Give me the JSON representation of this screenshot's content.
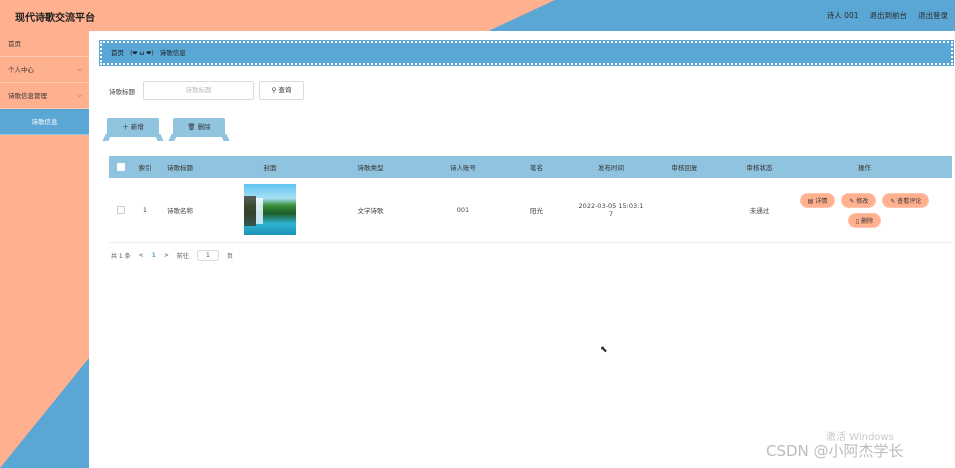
{
  "header": {
    "title": "现代诗歌交流平台",
    "nav": [
      "诗人 001",
      "退出到前台",
      "退出登录"
    ]
  },
  "sidebar": {
    "items": [
      {
        "label": "首页",
        "has_arrow": false
      },
      {
        "label": "个人中心",
        "has_arrow": true
      },
      {
        "label": "诗歌信息管理",
        "has_arrow": true
      },
      {
        "label": "诗歌信息",
        "active": true
      }
    ]
  },
  "breadcrumb": {
    "home": "首页",
    "separator": "(❤ ω ❤)",
    "current": "诗歌信息"
  },
  "search": {
    "label": "诗歌标题",
    "placeholder": "诗歌标题",
    "button": "查询"
  },
  "actions": {
    "add": "新增",
    "delete": "删除"
  },
  "table": {
    "headers": [
      "索引",
      "诗歌标题",
      "封面",
      "诗歌类型",
      "诗人账号",
      "笔名",
      "发布时间",
      "审核回复",
      "审核状态",
      "操作"
    ],
    "rows": [
      {
        "index": "1",
        "title": "诗歌名称",
        "type": "文学诗歌",
        "account": "001",
        "pen_name": "阳光",
        "time_line1": "2022-03-05 15:03:1",
        "time_line2": "7",
        "reply": "",
        "status": "未通过",
        "ops": {
          "detail": "详情",
          "edit": "修改",
          "comments": "查看评论",
          "delete": "删除"
        }
      }
    ]
  },
  "pagination": {
    "total": "共 1 条",
    "prev": "<",
    "page": "1",
    "next": ">",
    "goto_prefix": "前往",
    "goto_value": "1",
    "goto_suffix": "页"
  },
  "watermarks": {
    "windows": "激活 Windows",
    "csdn": "CSDN @小阿杰学长"
  },
  "colors": {
    "accent_blue": "#5aa6d4",
    "accent_peach": "#ffb08e",
    "table_header": "#8fc3df"
  }
}
